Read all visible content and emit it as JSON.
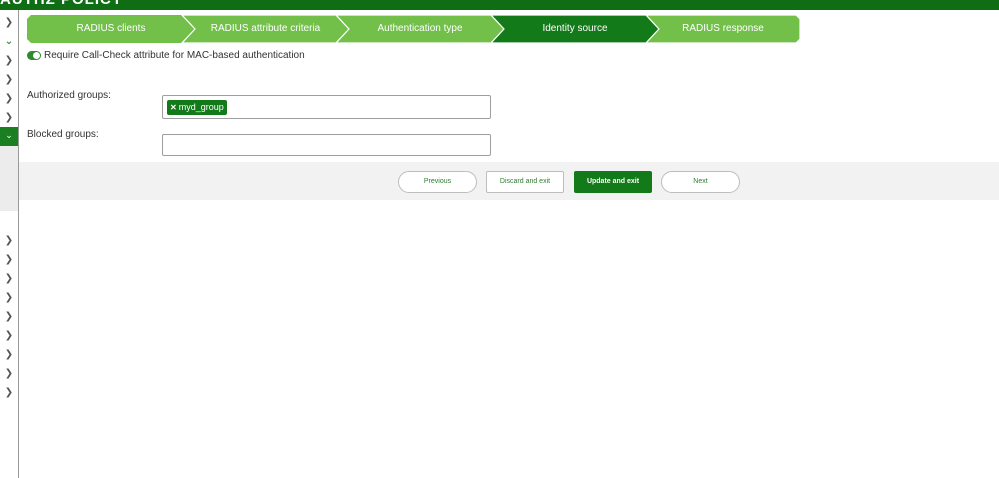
{
  "header": {
    "title": "AUTHZ POLICY"
  },
  "wizard": {
    "steps": [
      {
        "label": "RADIUS clients",
        "state": "completed"
      },
      {
        "label": "RADIUS attribute criteria",
        "state": "completed"
      },
      {
        "label": "Authentication type",
        "state": "completed"
      },
      {
        "label": "Identity source",
        "state": "active"
      },
      {
        "label": "RADIUS response",
        "state": "upcoming"
      }
    ],
    "colors": {
      "completed": "#72c04a",
      "active": "#137a19",
      "upcoming": "#72c04a"
    }
  },
  "form": {
    "call_check": {
      "label": "Require Call-Check attribute for MAC-based authentication",
      "enabled": true
    },
    "authorized_groups": {
      "label": "Authorized groups:",
      "tags": [
        "myd_group"
      ],
      "value": ""
    },
    "blocked_groups": {
      "label": "Blocked groups:",
      "value": ""
    }
  },
  "actions": {
    "previous": "Previous",
    "discard": "Discard and exit",
    "update": "Update and exit",
    "next": "Next"
  },
  "sidebar": {
    "icons": [
      "chevron-right-icon",
      "chevron-down-icon",
      "chevron-right-icon",
      "chevron-right-icon",
      "chevron-right-icon",
      "chevron-down-icon"
    ]
  }
}
